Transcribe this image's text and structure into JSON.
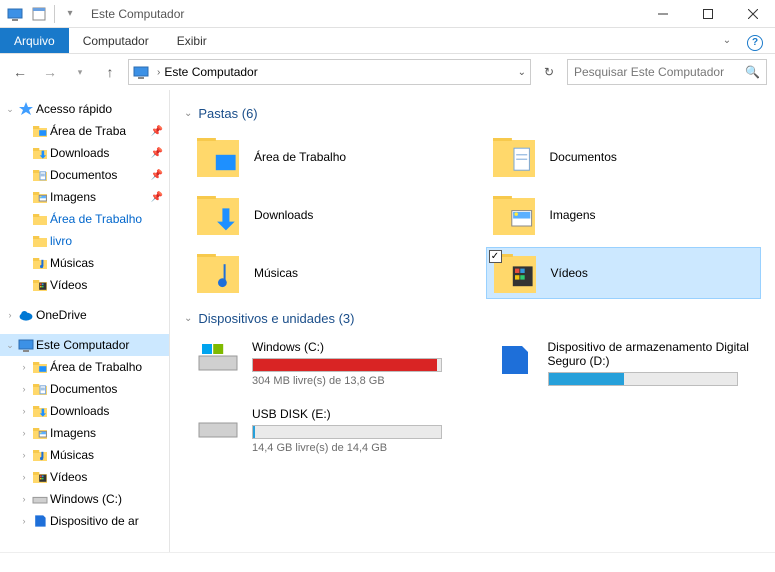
{
  "window": {
    "title": "Este Computador"
  },
  "ribbon": {
    "tabs": {
      "file": "Arquivo",
      "computer": "Computador",
      "view": "Exibir"
    }
  },
  "nav": {
    "breadcrumb": "Este Computador",
    "search_placeholder": "Pesquisar Este Computador"
  },
  "tree": {
    "quick_access": "Acesso rápido",
    "qa_items": [
      {
        "label": "Área de Traba",
        "pinned": true,
        "icon": "desktop"
      },
      {
        "label": "Downloads",
        "pinned": true,
        "icon": "downloads"
      },
      {
        "label": "Documentos",
        "pinned": true,
        "icon": "documents"
      },
      {
        "label": "Imagens",
        "pinned": true,
        "icon": "images"
      },
      {
        "label": "Área de Trabalho",
        "pinned": false,
        "icon": "folder",
        "link": true
      },
      {
        "label": "livro",
        "pinned": false,
        "icon": "folder",
        "link": true
      },
      {
        "label": "Músicas",
        "pinned": false,
        "icon": "music"
      },
      {
        "label": "Vídeos",
        "pinned": false,
        "icon": "videos"
      }
    ],
    "onedrive": "OneDrive",
    "this_pc": "Este Computador",
    "pc_items": [
      {
        "label": "Área de Trabalho",
        "icon": "desktop"
      },
      {
        "label": "Documentos",
        "icon": "documents"
      },
      {
        "label": "Downloads",
        "icon": "downloads"
      },
      {
        "label": "Imagens",
        "icon": "images"
      },
      {
        "label": "Músicas",
        "icon": "music"
      },
      {
        "label": "Vídeos",
        "icon": "videos"
      },
      {
        "label": "Windows (C:)",
        "icon": "drive"
      },
      {
        "label": "Dispositivo de ar",
        "icon": "sd"
      }
    ]
  },
  "content": {
    "folders_header": "Pastas (6)",
    "folders": [
      {
        "label": "Área de Trabalho",
        "icon": "desktop"
      },
      {
        "label": "Documentos",
        "icon": "documents"
      },
      {
        "label": "Downloads",
        "icon": "downloads"
      },
      {
        "label": "Imagens",
        "icon": "images"
      },
      {
        "label": "Músicas",
        "icon": "music"
      },
      {
        "label": "Vídeos",
        "icon": "videos",
        "selected": true
      }
    ],
    "drives_header": "Dispositivos e unidades (3)",
    "drives": [
      {
        "name": "Windows (C:)",
        "free": "304 MB livre(s) de 13,8 GB",
        "pct": 98,
        "color": "#D92424",
        "icon": "winhd"
      },
      {
        "name": "Dispositivo de armazenamento Digital Seguro (D:)",
        "free": "",
        "pct": 40,
        "color": "#26A0DA",
        "icon": "sd"
      },
      {
        "name": "USB DISK (E:)",
        "free": "14,4 GB livre(s) de 14,4 GB",
        "pct": 1,
        "color": "#26A0DA",
        "icon": "usb"
      }
    ]
  },
  "statusbar": ""
}
